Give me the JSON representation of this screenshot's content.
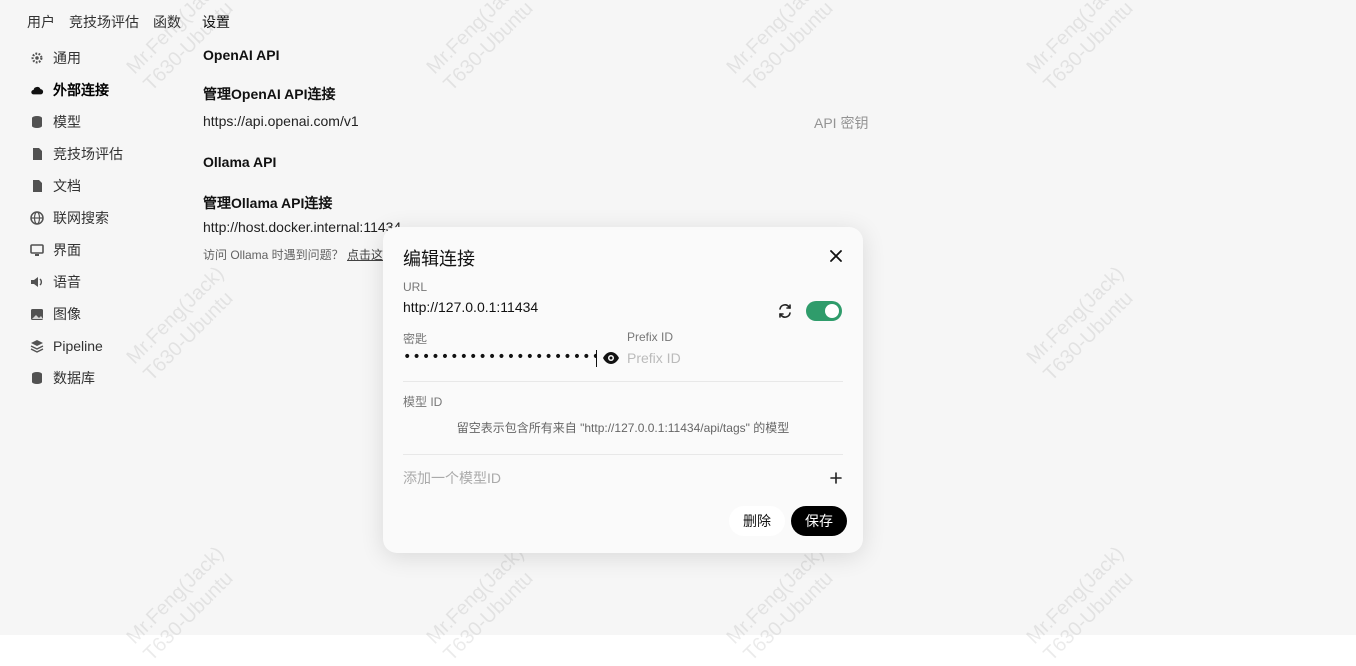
{
  "nav": {
    "tabs": [
      "用户",
      "竞技场评估",
      "函数",
      "设置"
    ]
  },
  "sidebar": {
    "items": [
      {
        "label": "通用",
        "icon": "gear-icon"
      },
      {
        "label": "外部连接",
        "icon": "cloud-icon",
        "active": true
      },
      {
        "label": "模型",
        "icon": "database-icon"
      },
      {
        "label": "竞技场评估",
        "icon": "document-icon"
      },
      {
        "label": "文档",
        "icon": "document-icon"
      },
      {
        "label": "联网搜索",
        "icon": "globe-icon"
      },
      {
        "label": "界面",
        "icon": "monitor-icon"
      },
      {
        "label": "语音",
        "icon": "speaker-icon"
      },
      {
        "label": "图像",
        "icon": "image-icon"
      },
      {
        "label": "Pipeline",
        "icon": "layers-icon"
      },
      {
        "label": "数据库",
        "icon": "database-icon"
      }
    ]
  },
  "content": {
    "openai_title": "OpenAI API",
    "openai_manage": "管理OpenAI API连接",
    "openai_url": "https://api.openai.com/v1",
    "openai_key_label": "API 密钥",
    "ollama_title": "Ollama API",
    "ollama_manage": "管理Ollama API连接",
    "ollama_url": "http://host.docker.internal:11434",
    "ollama_trouble": "访问 Ollama 时遇到问题？",
    "ollama_link": "点击这"
  },
  "watermark": "Mr.Feng(Jack)\nT630-Ubuntu",
  "modal": {
    "title": "编辑连接",
    "url_label": "URL",
    "url_value": "http://127.0.0.1:11434",
    "key_label": "密匙",
    "key_value": "••••••••••••••••••••••••••••••••••••••••",
    "prefix_label": "Prefix ID",
    "prefix_placeholder": "Prefix ID",
    "model_id_label": "模型 ID",
    "model_hint": "留空表示包含所有来自 \"http://127.0.0.1:11434/api/tags\" 的模型",
    "add_model_placeholder": "添加一个模型ID",
    "delete_label": "删除",
    "save_label": "保存",
    "toggle_on": true,
    "accent_color": "#2f9c6b"
  }
}
